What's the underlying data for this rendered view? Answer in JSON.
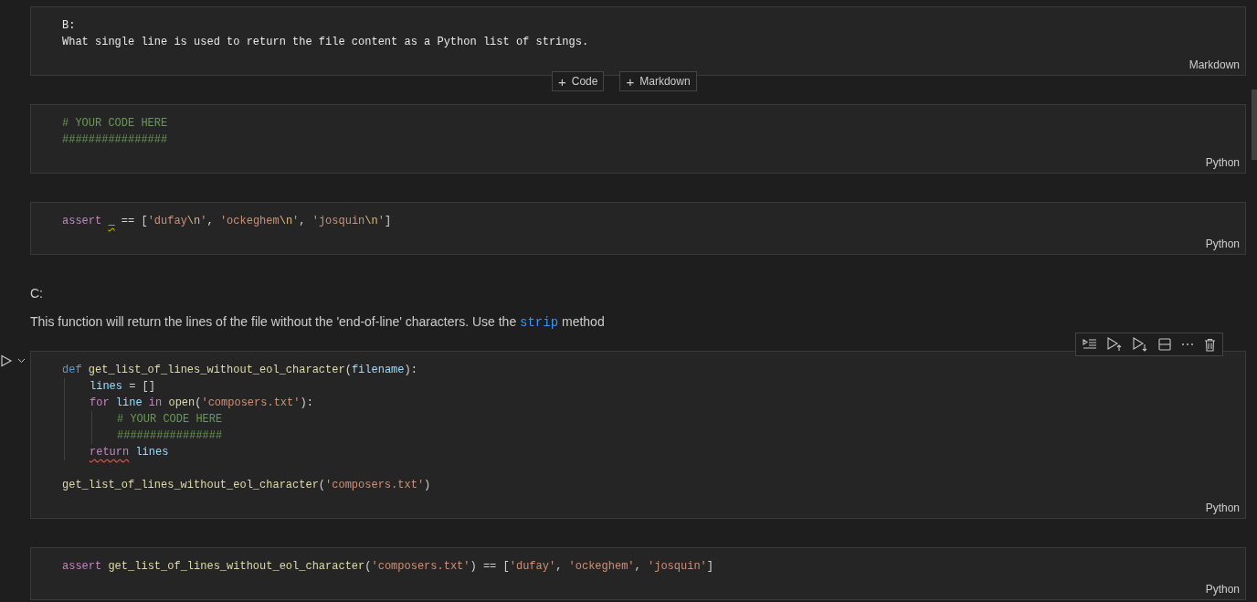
{
  "cells": [
    {
      "kind": "raw",
      "language": "Markdown",
      "lines": [
        {
          "tokens": [
            {
              "text": "B:"
            }
          ]
        },
        {
          "tokens": [
            {
              "text": "What single line is used to return the file content as a Python list of strings."
            }
          ]
        }
      ]
    },
    {
      "kind": "add_buttons",
      "buttons": [
        {
          "icon": "+",
          "label": "Code"
        },
        {
          "icon": "+",
          "label": "Markdown"
        }
      ]
    },
    {
      "kind": "code",
      "language": "Python",
      "focused": false,
      "lines": [
        {
          "tokens": [
            {
              "text": "# YOUR CODE HERE",
              "kind": "comment"
            }
          ]
        },
        {
          "tokens": [
            {
              "text": "################",
              "kind": "comment"
            }
          ]
        }
      ]
    },
    {
      "kind": "code",
      "language": "Python",
      "focused": false,
      "lines": [
        {
          "tokens": [
            {
              "text": "assert ",
              "kind": "control"
            },
            {
              "text": "_",
              "kind": "plain",
              "warning": true
            },
            {
              "text": " == [",
              "kind": "plain"
            },
            {
              "text": "'dufay",
              "kind": "string"
            },
            {
              "text": "\\n",
              "kind": "escape"
            },
            {
              "text": "'",
              "kind": "string"
            },
            {
              "text": ", ",
              "kind": "plain"
            },
            {
              "text": "'ockeghem",
              "kind": "string"
            },
            {
              "text": "\\n",
              "kind": "escape"
            },
            {
              "text": "'",
              "kind": "string"
            },
            {
              "text": ", ",
              "kind": "plain"
            },
            {
              "text": "'josquin",
              "kind": "string"
            },
            {
              "text": "\\n",
              "kind": "escape"
            },
            {
              "text": "'",
              "kind": "string"
            },
            {
              "text": "]",
              "kind": "plain"
            }
          ]
        }
      ]
    },
    {
      "kind": "markdown",
      "paragraphs": [
        [
          {
            "text": "C:",
            "kind": "text"
          }
        ],
        [
          {
            "text": "This function will return the lines of the file without the 'end-of-line' characters. Use the ",
            "kind": "text"
          },
          {
            "text": "strip",
            "kind": "code"
          },
          {
            "text": " method",
            "kind": "text"
          }
        ]
      ]
    },
    {
      "kind": "code",
      "language": "Python",
      "focused": true,
      "blocks": [
        {
          "lines": [
            {
              "tokens": [
                {
                  "text": "def ",
                  "kind": "keyword"
                },
                {
                  "text": "get_list_of_lines_without_eol_character",
                  "kind": "function"
                },
                {
                  "text": "(",
                  "kind": "plain"
                },
                {
                  "text": "filename",
                  "kind": "param"
                },
                {
                  "text": "):",
                  "kind": "plain"
                }
              ],
              "children": [
                {
                  "tokens": [
                    {
                      "text": "lines",
                      "kind": "variable"
                    },
                    {
                      "text": " = []",
                      "kind": "plain"
                    }
                  ]
                },
                {
                  "tokens": [
                    {
                      "text": "for ",
                      "kind": "control"
                    },
                    {
                      "text": "line",
                      "kind": "variable"
                    },
                    {
                      "text": " in ",
                      "kind": "control"
                    },
                    {
                      "text": "open",
                      "kind": "function"
                    },
                    {
                      "text": "(",
                      "kind": "plain"
                    },
                    {
                      "text": "'composers.txt'",
                      "kind": "string"
                    },
                    {
                      "text": "):",
                      "kind": "plain"
                    }
                  ],
                  "children": [
                    {
                      "tokens": [
                        {
                          "text": "# YOUR CODE HERE",
                          "kind": "comment"
                        }
                      ]
                    },
                    {
                      "tokens": [
                        {
                          "text": "################",
                          "kind": "comment"
                        }
                      ]
                    }
                  ]
                },
                {
                  "tokens": [
                    {
                      "text": "return",
                      "kind": "control",
                      "error": true
                    },
                    {
                      "text": " lines",
                      "kind": "variable"
                    }
                  ]
                }
              ]
            }
          ]
        },
        {
          "lines": [
            {
              "tokens": [
                {
                  "text": "get_list_of_lines_without_eol_character",
                  "kind": "function"
                },
                {
                  "text": "(",
                  "kind": "plain"
                },
                {
                  "text": "'composers.txt'",
                  "kind": "string"
                },
                {
                  "text": ")",
                  "kind": "plain"
                }
              ]
            }
          ]
        }
      ]
    },
    {
      "kind": "code",
      "language": "Python",
      "focused": false,
      "lines": [
        {
          "tokens": [
            {
              "text": "assert ",
              "kind": "control"
            },
            {
              "text": "get_list_of_lines_without_eol_character",
              "kind": "function"
            },
            {
              "text": "(",
              "kind": "plain"
            },
            {
              "text": "'composers.txt'",
              "kind": "string"
            },
            {
              "text": ") == [",
              "kind": "plain"
            },
            {
              "text": "'dufay'",
              "kind": "string"
            },
            {
              "text": ", ",
              "kind": "plain"
            },
            {
              "text": "'ockeghem'",
              "kind": "string"
            },
            {
              "text": ", ",
              "kind": "plain"
            },
            {
              "text": "'josquin'",
              "kind": "string"
            },
            {
              "text": "]",
              "kind": "plain"
            }
          ]
        }
      ]
    }
  ]
}
